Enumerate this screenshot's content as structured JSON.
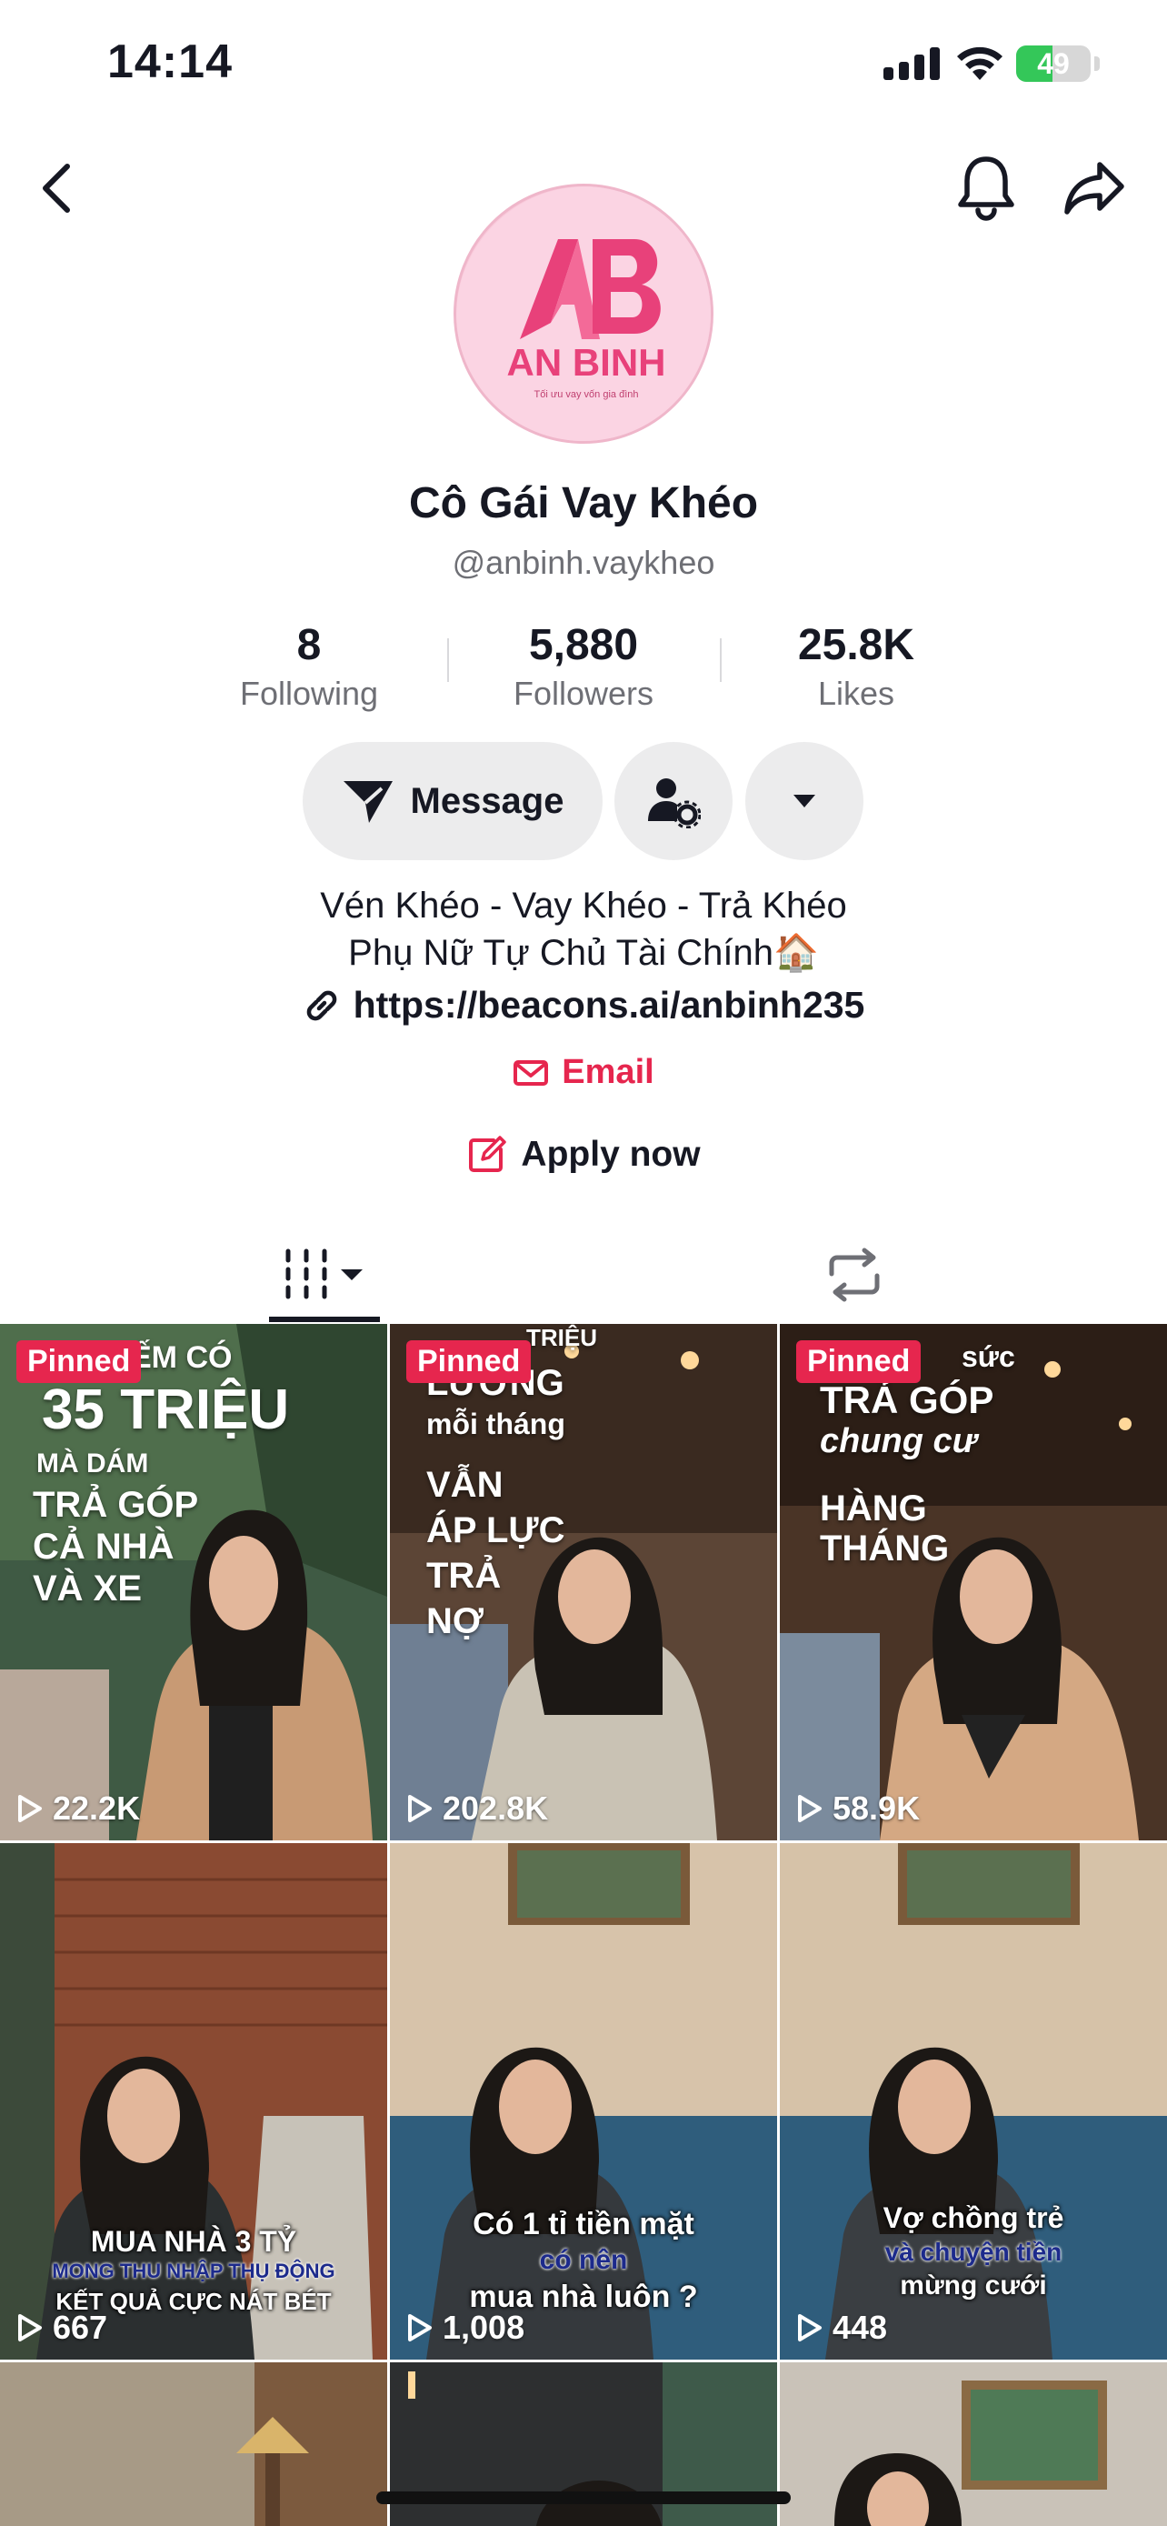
{
  "status_bar": {
    "time": "14:14",
    "battery_level": "49",
    "battery_percent": 49,
    "battery_color": "#34c759"
  },
  "nav": {
    "back_icon": "chevron-left-icon",
    "bell_icon": "bell-icon",
    "share_icon": "share-arrow-icon"
  },
  "profile": {
    "avatar_logo_text": "AN BINH",
    "avatar_tagline": "Tối ưu vay vốn gia đình",
    "display_name": "Cô Gái Vay Khéo",
    "username": "@anbinh.vaykheo"
  },
  "stats": [
    {
      "value": "8",
      "label": "Following"
    },
    {
      "value": "5,880",
      "label": "Followers"
    },
    {
      "value": "25.8K",
      "label": "Likes"
    }
  ],
  "actions": {
    "message_label": "Message",
    "message_icon": "send-icon",
    "friend_settings_icon": "user-settings-icon",
    "more_icon": "caret-down-icon"
  },
  "bio": {
    "line1": "Vén Khéo - Vay Khéo - Trả Khéo",
    "line2": "Phụ Nữ Tự Chủ Tài Chính🏠",
    "link": "https://beacons.ai/anbinh235",
    "email_label": "Email",
    "apply_label": "Apply now"
  },
  "tabs": {
    "videos_icon": "grid-icon",
    "reposts_icon": "repost-icon"
  },
  "videos": [
    {
      "pinned": true,
      "pinned_label": "Pinned",
      "views": "22.2K",
      "overlay": [
        "KIẾM CÓ",
        "35 TRIỆU",
        "MÀ DÁM",
        "TRẢ GÓP",
        "CẢ NHÀ",
        "VÀ XE"
      ]
    },
    {
      "pinned": true,
      "pinned_label": "Pinned",
      "views": "202.8K",
      "overlay": [
        "TRIỆU",
        "LƯƠNG",
        "mỗi tháng",
        "VẪN",
        "ÁP LỰC",
        "TRẢ",
        "NỢ"
      ]
    },
    {
      "pinned": true,
      "pinned_label": "Pinned",
      "views": "58.9K",
      "overlay": [
        "sức",
        "TRẢ GÓP",
        "chung cư",
        "HÀNG",
        "THÁNG"
      ]
    },
    {
      "pinned": false,
      "views": "667",
      "caption": [
        "MUA NHÀ 3 TỶ",
        "MONG THU NHẬP THỤ ĐỘNG",
        "KẾT QUẢ CỰC NÁT BÉT"
      ]
    },
    {
      "pinned": false,
      "views": "1,008",
      "caption": [
        "Có 1 tỉ tiền mặt",
        "có nên",
        "mua nhà luôn ?"
      ]
    },
    {
      "pinned": false,
      "views": "448",
      "caption": [
        "Vợ chồng trẻ",
        "và chuyện tiền",
        "mừng cưới"
      ]
    }
  ]
}
